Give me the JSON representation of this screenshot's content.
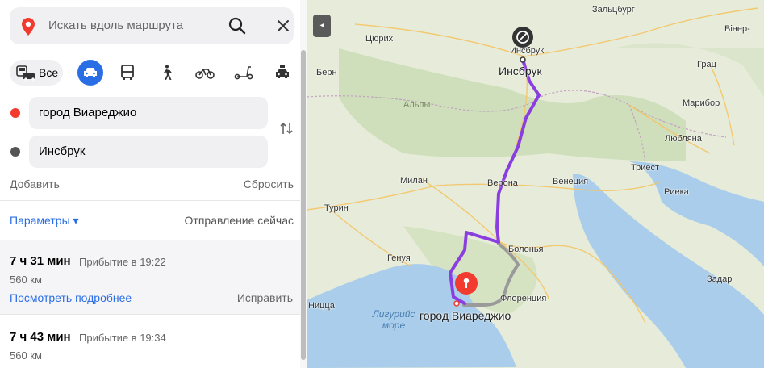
{
  "search": {
    "placeholder": "Искать вдоль маршрута"
  },
  "modes": {
    "all_label": "Все"
  },
  "route_points": {
    "from": "город Виареджио",
    "to": "Инсбрук"
  },
  "actions": {
    "add": "Добавить",
    "reset": "Сбросить"
  },
  "params": {
    "label": "Параметры ▾",
    "departure": "Отправление сейчас"
  },
  "routes": [
    {
      "duration": "7 ч 31 мин",
      "arrival": "Прибытие в 19:22",
      "distance": "560 км",
      "details": "Посмотреть подробнее",
      "fix": "Исправить"
    },
    {
      "duration": "7 ч 43 мин",
      "arrival": "Прибытие в 19:34",
      "distance": "560 км"
    }
  ],
  "map": {
    "collapse_glyph": "◂",
    "cities": {
      "salzburg": "Зальцбург",
      "vienna": "Вінер-",
      "zurich": "Цюрих",
      "innsbruck_small": "Инсбрук",
      "innsbruck": "Инсбрук",
      "graz": "Грац",
      "bern": "Берн",
      "alps": "Альпы",
      "maribor": "Марибор",
      "ljubljana": "Любляна",
      "trieste": "Триест",
      "venice": "Венеция",
      "rijeka": "Риека",
      "milan": "Милан",
      "verona": "Верона",
      "turin": "Турин",
      "zadar": "Задар",
      "bologna": "Болонья",
      "genoa": "Генуя",
      "florence": "Флоренция",
      "nice": "Ницца",
      "viareggio": "город Виареджио"
    },
    "sea_line1": "Лигурийс",
    "sea_line2": "море"
  },
  "colors": {
    "accent": "#2a6ee6",
    "route": "#8a3ee0",
    "start_dot": "#f33a2e",
    "end_dot": "#555555",
    "alt_route": "#9a9a9a"
  }
}
